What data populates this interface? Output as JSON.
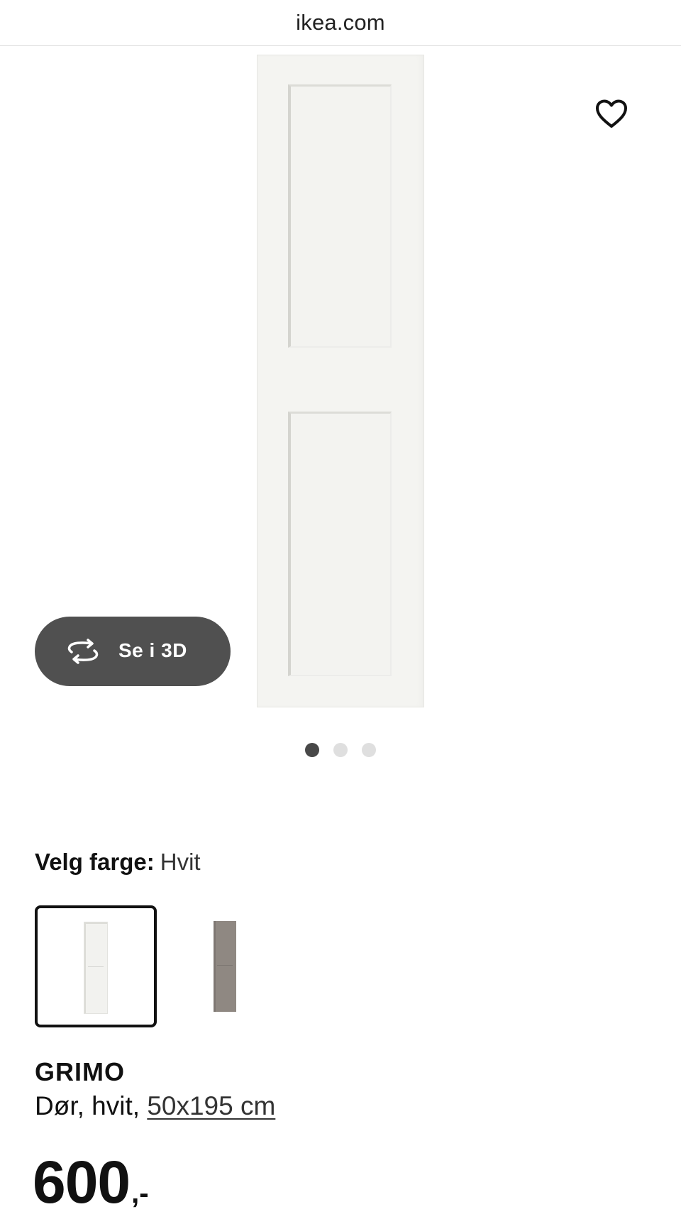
{
  "browser": {
    "url": "ikea.com"
  },
  "gallery": {
    "button_3d_label": "Se i 3D",
    "favorite_icon": "heart-outline-icon",
    "rotate_icon": "rotate-3d-icon",
    "slides_total": 3,
    "active_slide": 1
  },
  "color_picker": {
    "label": "Velg farge:",
    "selected_value": "Hvit",
    "options_count": 2,
    "colors": {
      "white": "#f2f2ef",
      "grey": "#8f8882"
    }
  },
  "product": {
    "name": "GRIMO",
    "description_prefix": "Dør, hvit, ",
    "size_link": "50x195 cm",
    "price_amount": "600",
    "price_suffix": ",-"
  },
  "colors": {
    "button_dark": "#505050",
    "dot_active": "#484848",
    "dot_inactive": "#dfdfdf"
  }
}
